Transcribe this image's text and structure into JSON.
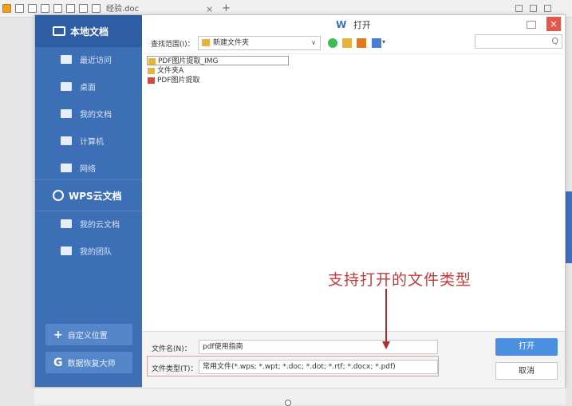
{
  "app": {
    "doc_tab": "经验.doc",
    "tab_close": "×",
    "tab_new": "+"
  },
  "dialog": {
    "title": "打开",
    "logo": "W",
    "close_glyph": "×",
    "sidebar": {
      "local_docs": "本地文档",
      "items": [
        "最近访问",
        "桌面",
        "我的文档",
        "计算机",
        "网络"
      ],
      "cloud_docs": "WPS云文档",
      "cloud_items": [
        "我的云文档",
        "我的团队"
      ],
      "custom_location": "自定义位置",
      "data_recovery": "数据恢复大师",
      "custom_glyph": "+",
      "recovery_glyph": "G"
    },
    "toolbar": {
      "look_in_label": "查找范围(I)：",
      "look_in_value": "新建文件夹",
      "dropdown_glyph": "∨",
      "view_dropdown": "▾"
    },
    "search": {
      "glyph": "Q"
    },
    "files": [
      {
        "name": "PDF图片提取_IMG",
        "type": "folder",
        "selected": true
      },
      {
        "name": "文件夹A",
        "type": "folder",
        "selected": false
      },
      {
        "name": "PDF图片提取",
        "type": "pdf",
        "selected": false
      }
    ],
    "filename_label": "文件名(N)：",
    "filename_value": "pdf使用指南",
    "filetype_label": "文件类型(T)：",
    "filetype_value": "常用文件(*.wps; *.wpt; *.doc; *.dot; *.rtf; *.docx; *.pdf)",
    "open_button": "打开",
    "cancel_button": "取消"
  },
  "annotation": {
    "text": "支持打开的文件类型",
    "color": "#c23a3a"
  },
  "colors": {
    "sidebar": "#3c6fb5",
    "accent": "#4b8fe0",
    "close": "#e5574b"
  }
}
